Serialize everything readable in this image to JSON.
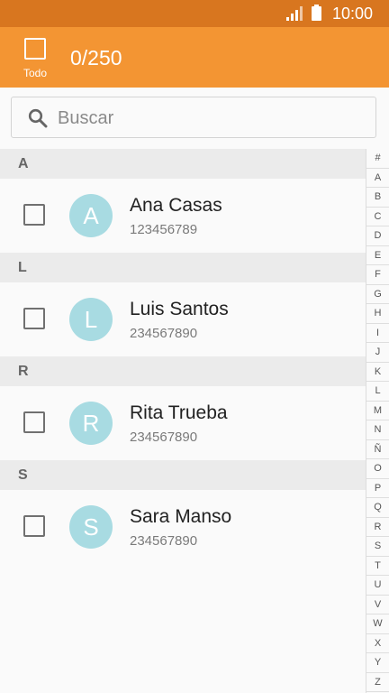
{
  "status_bar": {
    "time": "10:00"
  },
  "toolbar": {
    "select_all_label": "Todo",
    "selection_count": "0/250"
  },
  "search": {
    "placeholder": "Buscar"
  },
  "sections": [
    {
      "letter": "A",
      "contacts": [
        {
          "initial": "A",
          "name": "Ana Casas",
          "phone": "123456789"
        }
      ]
    },
    {
      "letter": "L",
      "contacts": [
        {
          "initial": "L",
          "name": "Luis Santos",
          "phone": "234567890"
        }
      ]
    },
    {
      "letter": "R",
      "contacts": [
        {
          "initial": "R",
          "name": "Rita Trueba",
          "phone": "234567890"
        }
      ]
    },
    {
      "letter": "S",
      "contacts": [
        {
          "initial": "S",
          "name": "Sara Manso",
          "phone": "234567890"
        }
      ]
    }
  ],
  "index_letters": [
    "#",
    "A",
    "B",
    "C",
    "D",
    "E",
    "F",
    "G",
    "H",
    "I",
    "J",
    "K",
    "L",
    "M",
    "N",
    "Ñ",
    "O",
    "P",
    "Q",
    "R",
    "S",
    "T",
    "U",
    "V",
    "W",
    "X",
    "Y",
    "Z"
  ],
  "colors": {
    "status_bar": "#d8761f",
    "app_bar": "#f39533",
    "avatar": "#a8dbe2",
    "section_bg": "#ebebeb"
  }
}
